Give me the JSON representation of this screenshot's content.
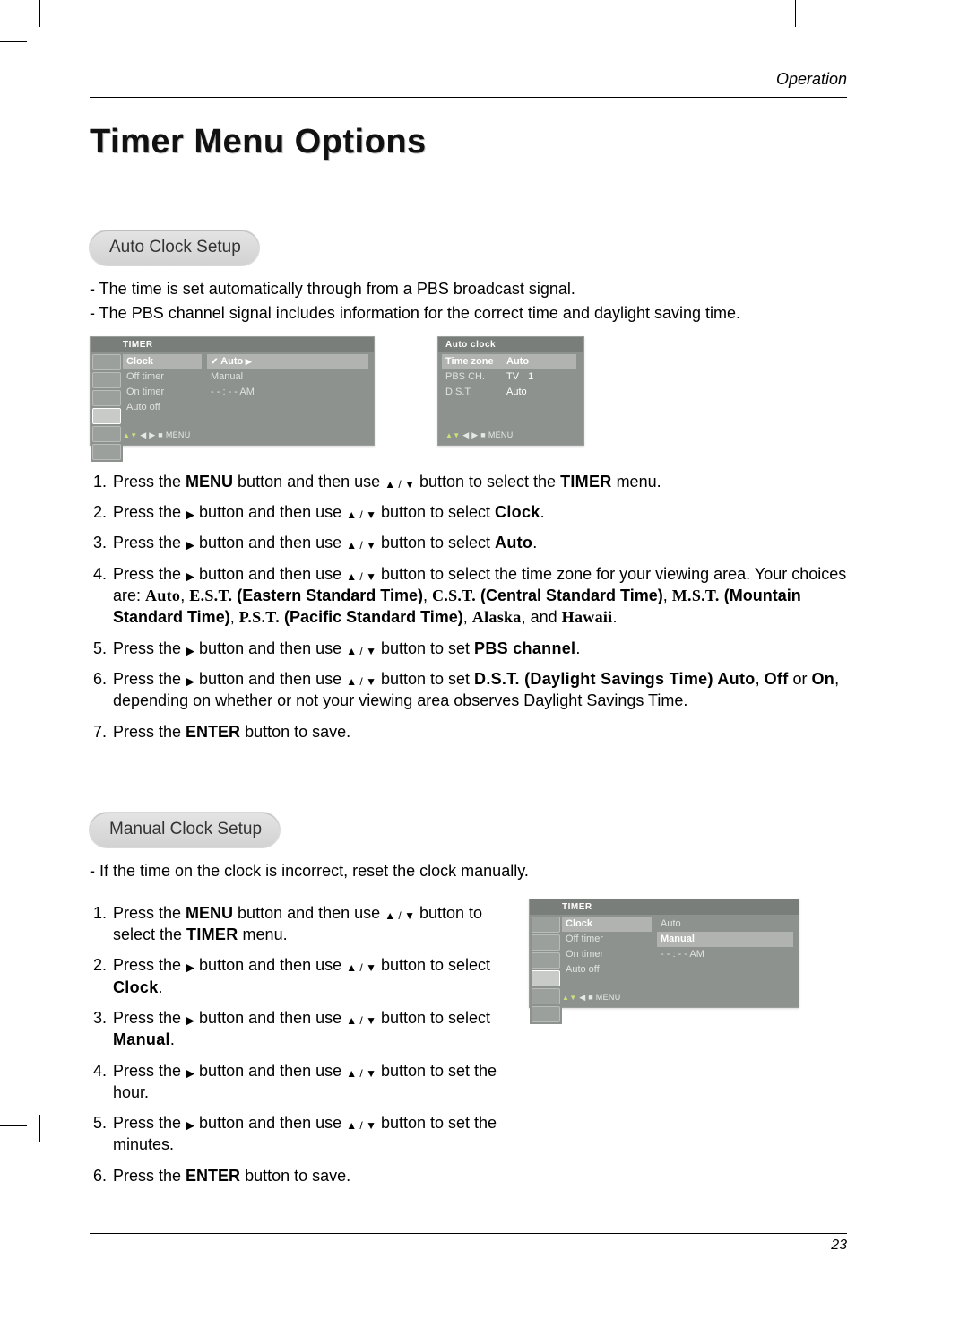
{
  "header": {
    "section": "Operation",
    "page_number": "23"
  },
  "title": "Timer Menu Options",
  "auto": {
    "heading": "Auto Clock Setup",
    "intro": [
      "The time is set automatically through from a PBS broadcast signal.",
      "The PBS channel signal includes information for the correct time and daylight saving time."
    ],
    "steps": {
      "s1a": "Press the ",
      "s1_menu": "MENU",
      "s1b": " button and then use ",
      "s1c": " button to select the ",
      "s1_timer": "TIMER",
      "s1d": " menu.",
      "s2a": "Press the ",
      "s2b": " button and then use ",
      "s2c": " button to select ",
      "s2_clock": "Clock",
      "s2d": ".",
      "s3a": "Press the ",
      "s3b": " button and then use ",
      "s3c": " button to select ",
      "s3_auto": "Auto",
      "s3d": ".",
      "s4a": "Press the ",
      "s4b": " button and then use ",
      "s4c": " button to select the time zone for your viewing area. Your choices are: ",
      "s4_auto": "Auto",
      "s4_comma1": ", ",
      "s4_est": "E.S.T.",
      "s4_est_d": " (Eastern Standard Time)",
      "s4_comma2": ", ",
      "s4_cst": "C.S.T.",
      "s4_cst_d": " (Central Standard Time)",
      "s4_comma3": ", ",
      "s4_mst": "M.S.T.",
      "s4_mst_d": " (Mountain Standard Time)",
      "s4_comma4": ", ",
      "s4_pst": "P.S.T.",
      "s4_pst_d": " (Pacific Standard Time)",
      "s4_comma5": ", ",
      "s4_ak": "Alaska",
      "s4_and": ", and ",
      "s4_hi": "Hawaii",
      "s4_period": ".",
      "s5a": "Press the ",
      "s5b": " button and then use ",
      "s5c": " button to set ",
      "s5_pbs": "PBS channel",
      "s5d": ".",
      "s6a": "Press the ",
      "s6b": " button and then use ",
      "s6c": " button to set ",
      "s6_dst": "D.S.T. (Daylight Savings Time) Auto",
      "s6_comma": ", ",
      "s6_off": "Off",
      "s6_or": " or ",
      "s6_on": "On",
      "s6d": ", depending on whether or not your viewing area observes Daylight Savings Time.",
      "s7a": "Press the ",
      "s7_enter": "ENTER",
      "s7b": " button to save."
    }
  },
  "manual": {
    "heading": "Manual Clock Setup",
    "intro": [
      "If the time on the clock is incorrect, reset the clock manually."
    ],
    "steps": {
      "s1a": "Press the ",
      "s1_menu": "MENU",
      "s1b": " button and then use ",
      "s1c": " button to select the ",
      "s1_timer": "TIMER",
      "s1d": " menu.",
      "s2a": "Press the ",
      "s2b": " button and then use ",
      "s2c": " button to select ",
      "s2_clock": "Clock",
      "s2d": ".",
      "s3a": "Press the ",
      "s3b": " button and then use ",
      "s3c": " button to select ",
      "s3_manual": "Manual",
      "s3d": ".",
      "s4a": "Press the ",
      "s4b": " button and then use ",
      "s4c": " button to set the hour.",
      "s5a": "Press the ",
      "s5b": " button and then use ",
      "s5c": " button to set the minutes.",
      "s6a": "Press the ",
      "s6_enter": "ENTER",
      "s6b": " button to save."
    }
  },
  "osd1": {
    "title": "TIMER",
    "left": {
      "clock": "Clock",
      "off": "Off timer",
      "on": "On timer",
      "autooff": "Auto off"
    },
    "right": {
      "auto": "Auto",
      "manual": "Manual",
      "time": "- - : - -  AM"
    },
    "footer": "◀ ▶  ■  MENU",
    "footer_pre": "▲▼"
  },
  "osd2": {
    "title": "Auto clock",
    "rows": {
      "tz_k": "Time zone",
      "tz_v": "Auto",
      "pbs_k": "PBS CH.",
      "pbs_v": "TV",
      "pbs_n": "1",
      "dst_k": "D.S.T.",
      "dst_v": "Auto"
    },
    "footer": "◀ ▶  ■  MENU",
    "footer_pre": "▲▼"
  },
  "osd3": {
    "title": "TIMER",
    "left": {
      "clock": "Clock",
      "off": "Off timer",
      "on": "On timer",
      "autooff": "Auto off"
    },
    "right": {
      "auto": "Auto",
      "manual": "Manual",
      "time": "- - : - -  AM"
    },
    "footer": "◀  ■  MENU",
    "footer_pre": "▲▼"
  }
}
